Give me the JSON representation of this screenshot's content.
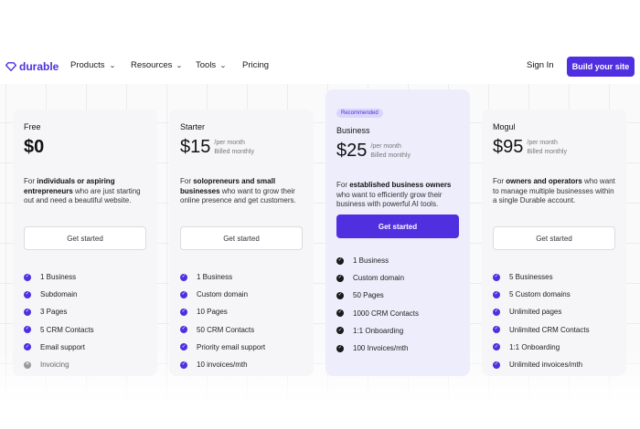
{
  "brand": {
    "name": "durable",
    "color": "#4f2fe0"
  },
  "nav": {
    "menu": [
      {
        "label": "Products",
        "dropdown": true
      },
      {
        "label": "Resources",
        "dropdown": true
      },
      {
        "label": "Tools",
        "dropdown": true
      },
      {
        "label": "Pricing",
        "dropdown": false
      }
    ],
    "sign_in": "Sign In",
    "cta": "Build your site"
  },
  "plans": [
    {
      "name": "Free",
      "price": "$0",
      "per": "",
      "billing": "",
      "desc_pre": "For ",
      "desc_bold": "individuals or aspiring entrepreneurs",
      "desc_post": " who are just starting out and need a beautiful website.",
      "cta": "Get started",
      "features": [
        {
          "text": "1 Business",
          "included": true
        },
        {
          "text": "Subdomain",
          "included": true
        },
        {
          "text": "3 Pages",
          "included": true
        },
        {
          "text": "5 CRM Contacts",
          "included": true
        },
        {
          "text": "Email support",
          "included": true
        },
        {
          "text": "Invoicing",
          "included": false
        }
      ]
    },
    {
      "name": "Starter",
      "price": "$15",
      "per": "/per month",
      "billing": "Billed monthly",
      "desc_pre": "For ",
      "desc_bold": "solopreneurs and small businesses",
      "desc_post": " who want to grow their online presence and get customers.",
      "cta": "Get started",
      "features": [
        {
          "text": "1 Business",
          "included": true
        },
        {
          "text": "Custom domain",
          "included": true
        },
        {
          "text": "10 Pages",
          "included": true
        },
        {
          "text": "50 CRM Contacts",
          "included": true
        },
        {
          "text": "Priority email support",
          "included": true
        },
        {
          "text": "10 invoices/mth",
          "included": true
        }
      ]
    },
    {
      "badge": "Recommended",
      "name": "Business",
      "price": "$25",
      "per": "/per month",
      "billing": "Billed monthly",
      "desc_pre": "For ",
      "desc_bold": "established business owners",
      "desc_post": " who want to efficiently grow their business with powerful AI tools.",
      "cta": "Get started",
      "features": [
        {
          "text": "1 Business",
          "included": true
        },
        {
          "text": "Custom domain",
          "included": true
        },
        {
          "text": "50 Pages",
          "included": true
        },
        {
          "text": "1000 CRM Contacts",
          "included": true
        },
        {
          "text": "1:1 Onboarding",
          "included": true
        },
        {
          "text": "100 Invoices/mth",
          "included": true
        }
      ]
    },
    {
      "name": "Mogul",
      "price": "$95",
      "per": "/per month",
      "billing": "Billed monthly",
      "desc_pre": "For ",
      "desc_bold": "owners and operators",
      "desc_post": " who want to manage multiple businesses within a single Durable account.",
      "cta": "Get started",
      "features": [
        {
          "text": "5 Businesses",
          "included": true
        },
        {
          "text": "5 Custom domains",
          "included": true
        },
        {
          "text": "Unlimited pages",
          "included": true
        },
        {
          "text": "Unlimited CRM Contacts",
          "included": true
        },
        {
          "text": "1:1 Onboarding",
          "included": true
        },
        {
          "text": "Unlimited invoices/mth",
          "included": true
        }
      ]
    }
  ],
  "colors": {
    "accent": "#4f2fe0",
    "recommended_bg": "#eeedfb",
    "card_bg": "#f6f6f8"
  }
}
